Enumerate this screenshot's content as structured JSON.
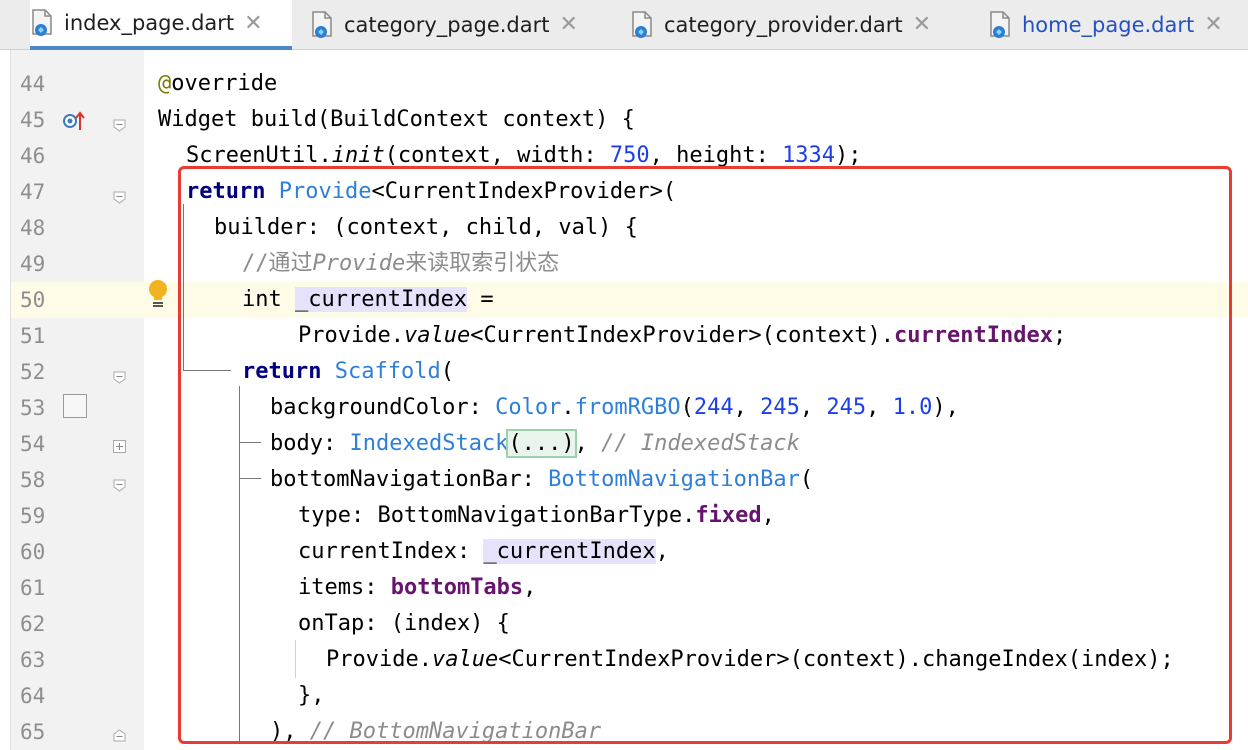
{
  "tabs": [
    {
      "label": "index_page.dart",
      "active": true
    },
    {
      "label": "category_page.dart",
      "active": false
    },
    {
      "label": "category_provider.dart",
      "active": false
    },
    {
      "label": "home_page.dart",
      "active": false
    }
  ],
  "close_glyph": "✕",
  "line_numbers": [
    "44",
    "45",
    "46",
    "47",
    "48",
    "49",
    "50",
    "51",
    "52",
    "53",
    "54",
    "58",
    "59",
    "60",
    "61",
    "62",
    "63",
    "64",
    "65"
  ],
  "code": {
    "l44": {
      "anno": "@",
      "text": "override"
    },
    "l45": {
      "text": "Widget build(BuildContext context) {"
    },
    "l46": {
      "a": "ScreenUtil.",
      "b": "init",
      "c": "(context, width: ",
      "d": "750",
      "e": ", height: ",
      "f": "1334",
      "g": ");"
    },
    "l47": {
      "a": "return",
      "b": "Provide",
      "c": "<CurrentIndexProvider>("
    },
    "l48": {
      "text": "builder: (context, child, val) {"
    },
    "l49": {
      "a": "//通过",
      "b": "Provide",
      "c": "来读取索引状态"
    },
    "l50": {
      "a": "int ",
      "b": "_currentIndex",
      "c": " ="
    },
    "l51": {
      "a": "Provide.",
      "b": "value",
      "c": "<CurrentIndexProvider>(context).",
      "d": "currentIndex",
      "e": ";"
    },
    "l52": {
      "a": "return",
      "b": "Scaffold",
      "c": "("
    },
    "l53": {
      "a": "backgroundColor: ",
      "b": "Color",
      "c": ".",
      "d": "fromRGBO",
      "e": "(",
      "f": "244",
      "g": ", ",
      "h": "245",
      "i": ", ",
      "j": "245",
      "k": ", ",
      "l": "1.0",
      "m": "),"
    },
    "l54": {
      "a": "body: ",
      "b": "IndexedStack",
      "c": "(...)",
      "d": ", ",
      "e": "// IndexedStack"
    },
    "l58": {
      "a": "bottomNavigationBar: ",
      "b": "BottomNavigationBar",
      "c": "("
    },
    "l59": {
      "a": "type: BottomNavigationBarType.",
      "b": "fixed",
      "c": ","
    },
    "l60": {
      "a": "currentIndex: ",
      "b": "_currentIndex",
      "c": ","
    },
    "l61": {
      "a": "items: ",
      "b": "bottomTabs",
      "c": ","
    },
    "l62": {
      "text": "onTap: (index) {"
    },
    "l63": {
      "a": "Provide.",
      "b": "value",
      "c": "<CurrentIndexProvider>(context).changeIndex(index);"
    },
    "l64": {
      "text": "},"
    },
    "l65": {
      "a": "), ",
      "b": "// BottomNavigationBar"
    }
  },
  "colors": {
    "keyword": "#000080",
    "class": "#2f7fd8",
    "number": "#1c3fea",
    "property": "#66146e",
    "highlight_box": "#ea3b33",
    "active_tab_underline": "#4a86c8"
  },
  "icons": [
    "dart-file-icon",
    "close-icon",
    "override-marker-icon",
    "lightbulb-icon",
    "fold-icon"
  ]
}
